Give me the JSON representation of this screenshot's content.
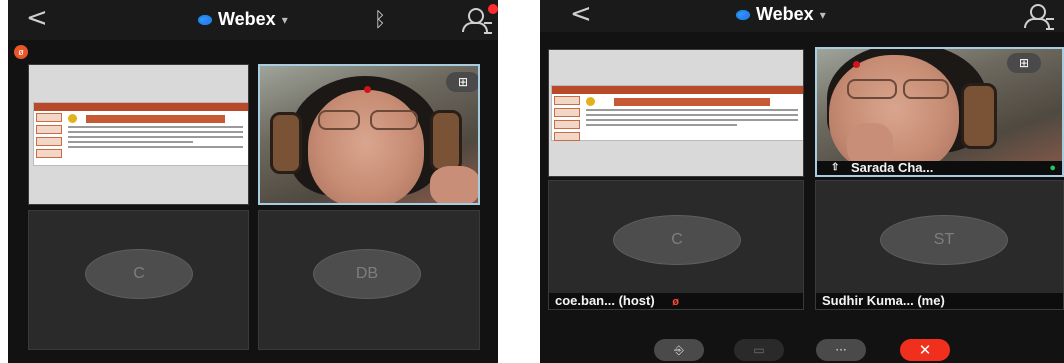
{
  "app": {
    "title": "Webex",
    "chevron": "⌵",
    "back_glyph": "<",
    "icons": [
      "back-chevron-icon",
      "webex-logo-icon",
      "bluetooth-icon",
      "participants-icon",
      "layout-grid-icon",
      "mute-icon",
      "microphone-icon",
      "share-icon",
      "video-off-icon",
      "more-icon",
      "end-call-icon"
    ]
  },
  "colors": {
    "panel_bg": "#121212",
    "end_call": "#f0301c",
    "mute_red": "#ff4a3a",
    "mic_green": "#25c35a",
    "selected_border": "#a8cde0"
  },
  "left": {
    "tiles": [
      {
        "kind": "screen-share"
      },
      {
        "kind": "video"
      },
      {
        "kind": "avatar",
        "initials": "C"
      },
      {
        "kind": "avatar",
        "initials": "DB"
      }
    ],
    "layout_button": "⊞"
  },
  "right": {
    "layout_button": "⊞",
    "tiles": [
      {
        "kind": "screen-share"
      },
      {
        "kind": "video",
        "name": "Sarada Cha..."
      },
      {
        "kind": "avatar",
        "initials": "C",
        "name": "coe.ban... (host)"
      },
      {
        "kind": "avatar",
        "initials": "ST",
        "name": "Sudhir Kuma... (me)"
      }
    ],
    "controls": [
      {
        "name": "audio",
        "glyph": "⎆"
      },
      {
        "name": "video",
        "glyph": "▭"
      },
      {
        "name": "more",
        "glyph": "···"
      },
      {
        "name": "end",
        "glyph": "✕"
      }
    ]
  }
}
